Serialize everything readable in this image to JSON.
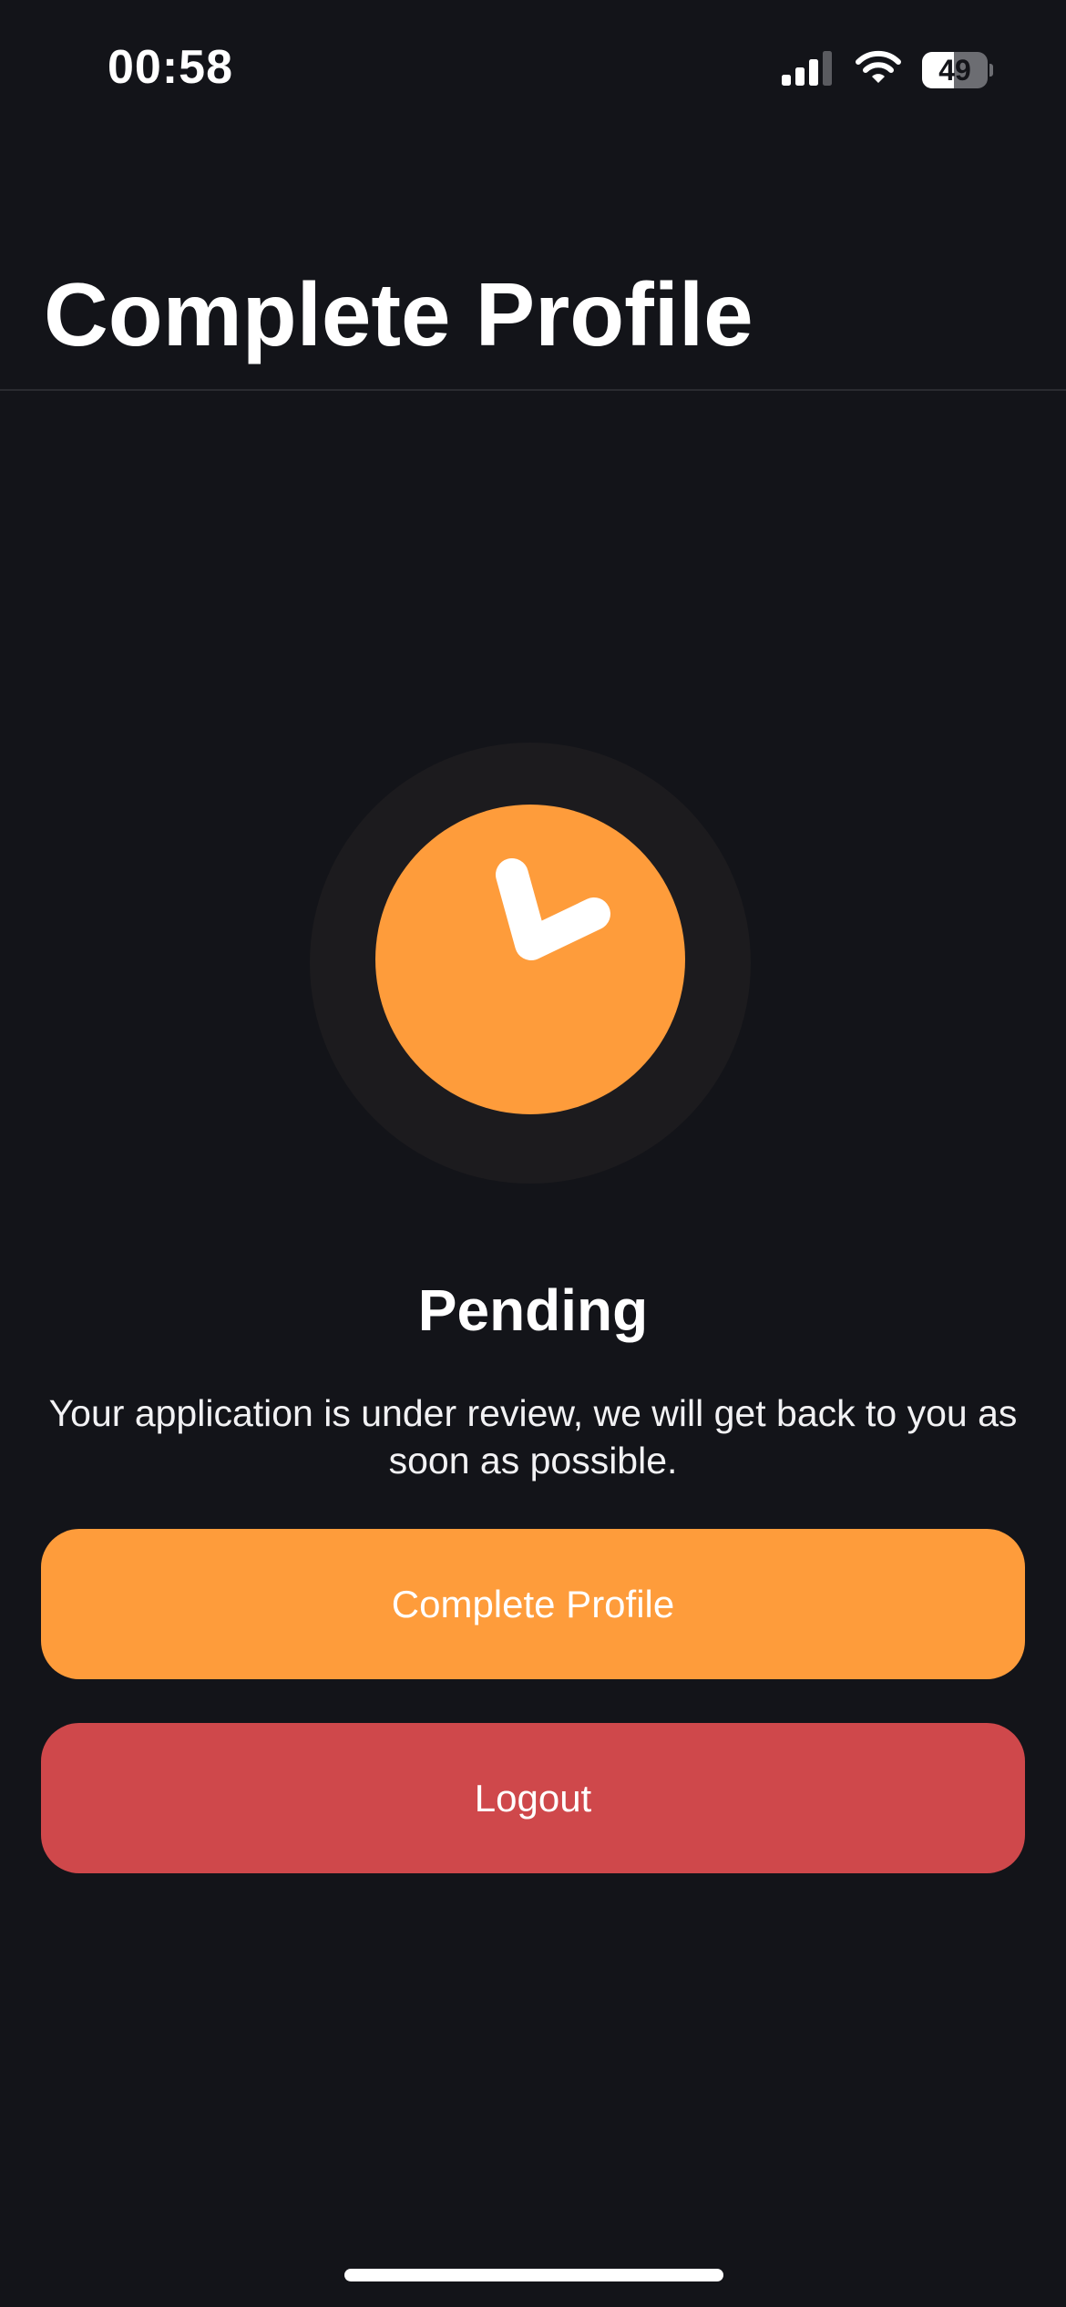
{
  "status_bar": {
    "time": "00:58",
    "battery_percent": 49,
    "battery_label": "49",
    "signal_icon": "cellular-signal-icon",
    "wifi_icon": "wifi-icon",
    "battery_icon": "battery-icon"
  },
  "header": {
    "title": "Complete Profile"
  },
  "status": {
    "icon": "clock-icon",
    "heading": "Pending",
    "message": "Your application is under review, we will get back to you as soon as possible."
  },
  "actions": {
    "complete_profile_label": "Complete Profile",
    "logout_label": "Logout"
  },
  "colors": {
    "background": "#131419",
    "accent_orange": "#fe9c3b",
    "danger_red": "#cf484b",
    "clock_halo": "#1c1b1e"
  }
}
